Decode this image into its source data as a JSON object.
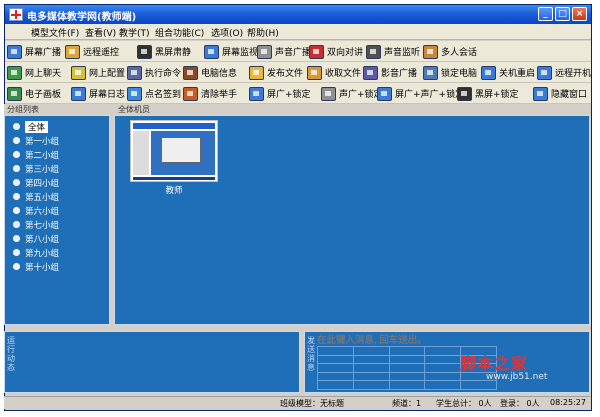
{
  "window": {
    "title": "电多媒体教学网(教师端)"
  },
  "menu": [
    {
      "label": "模型文件(F)"
    },
    {
      "label": "查看(V)"
    },
    {
      "label": "教学(T)"
    },
    {
      "label": "组合功能(C)"
    },
    {
      "label": "选项(O)"
    },
    {
      "label": "帮助(H)"
    }
  ],
  "toolbar_rows": [
    [
      {
        "label": "屏幕广播",
        "name": "screen-broadcast",
        "icon": "monitor-icon",
        "color": "#3a7ad8"
      },
      {
        "label": "远程遥控",
        "name": "remote-control",
        "icon": "remote-icon",
        "color": "#d8a838"
      },
      {
        "label": "黑屏肃静",
        "name": "black-screen",
        "icon": "black-screen-icon",
        "color": "#303030"
      },
      {
        "label": "屏幕监视",
        "name": "screen-monitor",
        "icon": "monitor-watch-icon",
        "color": "#3a7ad8"
      },
      {
        "label": "声音广播",
        "name": "voice-broadcast",
        "icon": "microphone-icon",
        "color": "#909090"
      },
      {
        "label": "双向对讲",
        "name": "two-way-talk",
        "icon": "intercom-icon",
        "color": "#c83030"
      },
      {
        "label": "声音监听",
        "name": "voice-monitor",
        "icon": "headphones-icon",
        "color": "#505050"
      },
      {
        "label": "多人会话",
        "name": "group-chat",
        "icon": "people-icon",
        "color": "#c88838"
      }
    ],
    [
      {
        "label": "网上聊天",
        "name": "online-chat",
        "icon": "chat-icon",
        "color": "#3a9a48"
      },
      {
        "label": "网上配置",
        "name": "online-config",
        "icon": "config-icon",
        "color": "#d8c038"
      },
      {
        "label": "执行命令",
        "name": "execute-command",
        "icon": "command-icon",
        "color": "#5a6a9a"
      },
      {
        "label": "电脑信息",
        "name": "computer-info",
        "icon": "info-icon",
        "color": "#8a4a28"
      },
      {
        "label": "发布文件",
        "name": "publish-file",
        "icon": "publish-file-icon",
        "color": "#e8b838"
      },
      {
        "label": "收取文件",
        "name": "collect-file",
        "icon": "collect-file-icon",
        "color": "#d89838"
      },
      {
        "label": "影音广播",
        "name": "video-broadcast",
        "icon": "video-icon",
        "color": "#5a5aa8"
      },
      {
        "label": "锁定电脑",
        "name": "lock-computer",
        "icon": "lock-icon",
        "color": "#4a7ab8"
      },
      {
        "label": "关机重启",
        "name": "shutdown-restart",
        "icon": "power-icon",
        "color": "#3a7ad8"
      },
      {
        "label": "远程开机",
        "name": "remote-boot",
        "icon": "remote-boot-icon",
        "color": "#3a7ad8"
      }
    ],
    [
      {
        "label": "电子画板",
        "name": "whiteboard",
        "icon": "whiteboard-icon",
        "color": "#3a8a48"
      },
      {
        "label": "屏幕日志",
        "name": "screen-log",
        "icon": "log-icon",
        "color": "#3a7ad8"
      },
      {
        "label": "点名签到",
        "name": "roll-call",
        "icon": "roll-call-icon",
        "color": "#3a8ad8"
      },
      {
        "label": "清除举手",
        "name": "clear-hands",
        "icon": "hand-icon",
        "color": "#c85a28"
      },
      {
        "label": "屏广+锁定",
        "name": "broadcast-lock",
        "icon": "broadcast-lock-icon",
        "color": "#3a7ad8"
      },
      {
        "label": "声广+锁定",
        "name": "voice-lock",
        "icon": "voice-lock-icon",
        "color": "#909090"
      },
      {
        "label": "屏广+声广+锁定",
        "name": "screen-voice-lock",
        "icon": "screen-voice-lock-icon",
        "color": "#3a7ad8"
      },
      {
        "label": "黑屏+锁定",
        "name": "black-lock",
        "icon": "black-lock-icon",
        "color": "#303030"
      },
      {
        "label": "隐藏窗口",
        "name": "hide-window",
        "icon": "hide-window-icon",
        "color": "#3a7ad8"
      }
    ]
  ],
  "panels": {
    "left_title": "分组列表",
    "right_title": "全体机员"
  },
  "groups": [
    {
      "label": "全体",
      "selected": true
    },
    {
      "label": "第一小组"
    },
    {
      "label": "第二小组"
    },
    {
      "label": "第三小组"
    },
    {
      "label": "第四小组"
    },
    {
      "label": "第五小组"
    },
    {
      "label": "第六小组"
    },
    {
      "label": "第七小组"
    },
    {
      "label": "第八小组"
    },
    {
      "label": "第九小组"
    },
    {
      "label": "第十小组"
    }
  ],
  "thumbnail": {
    "label": "教师"
  },
  "logs": {
    "left_label": "运行动态",
    "right_label": "发送消息",
    "message_placeholder": "在此键入消息, 回车送出。",
    "headers": [
      "",
      "",
      "",
      "",
      ""
    ]
  },
  "watermark": {
    "main": "脚本之家",
    "sub": "www.jb51.net"
  },
  "status": {
    "model": "班级模型：无标题",
    "channel": "频道：1",
    "students": "学生总计：  0人",
    "login": "登录：  0人",
    "time": "08:25:27"
  }
}
